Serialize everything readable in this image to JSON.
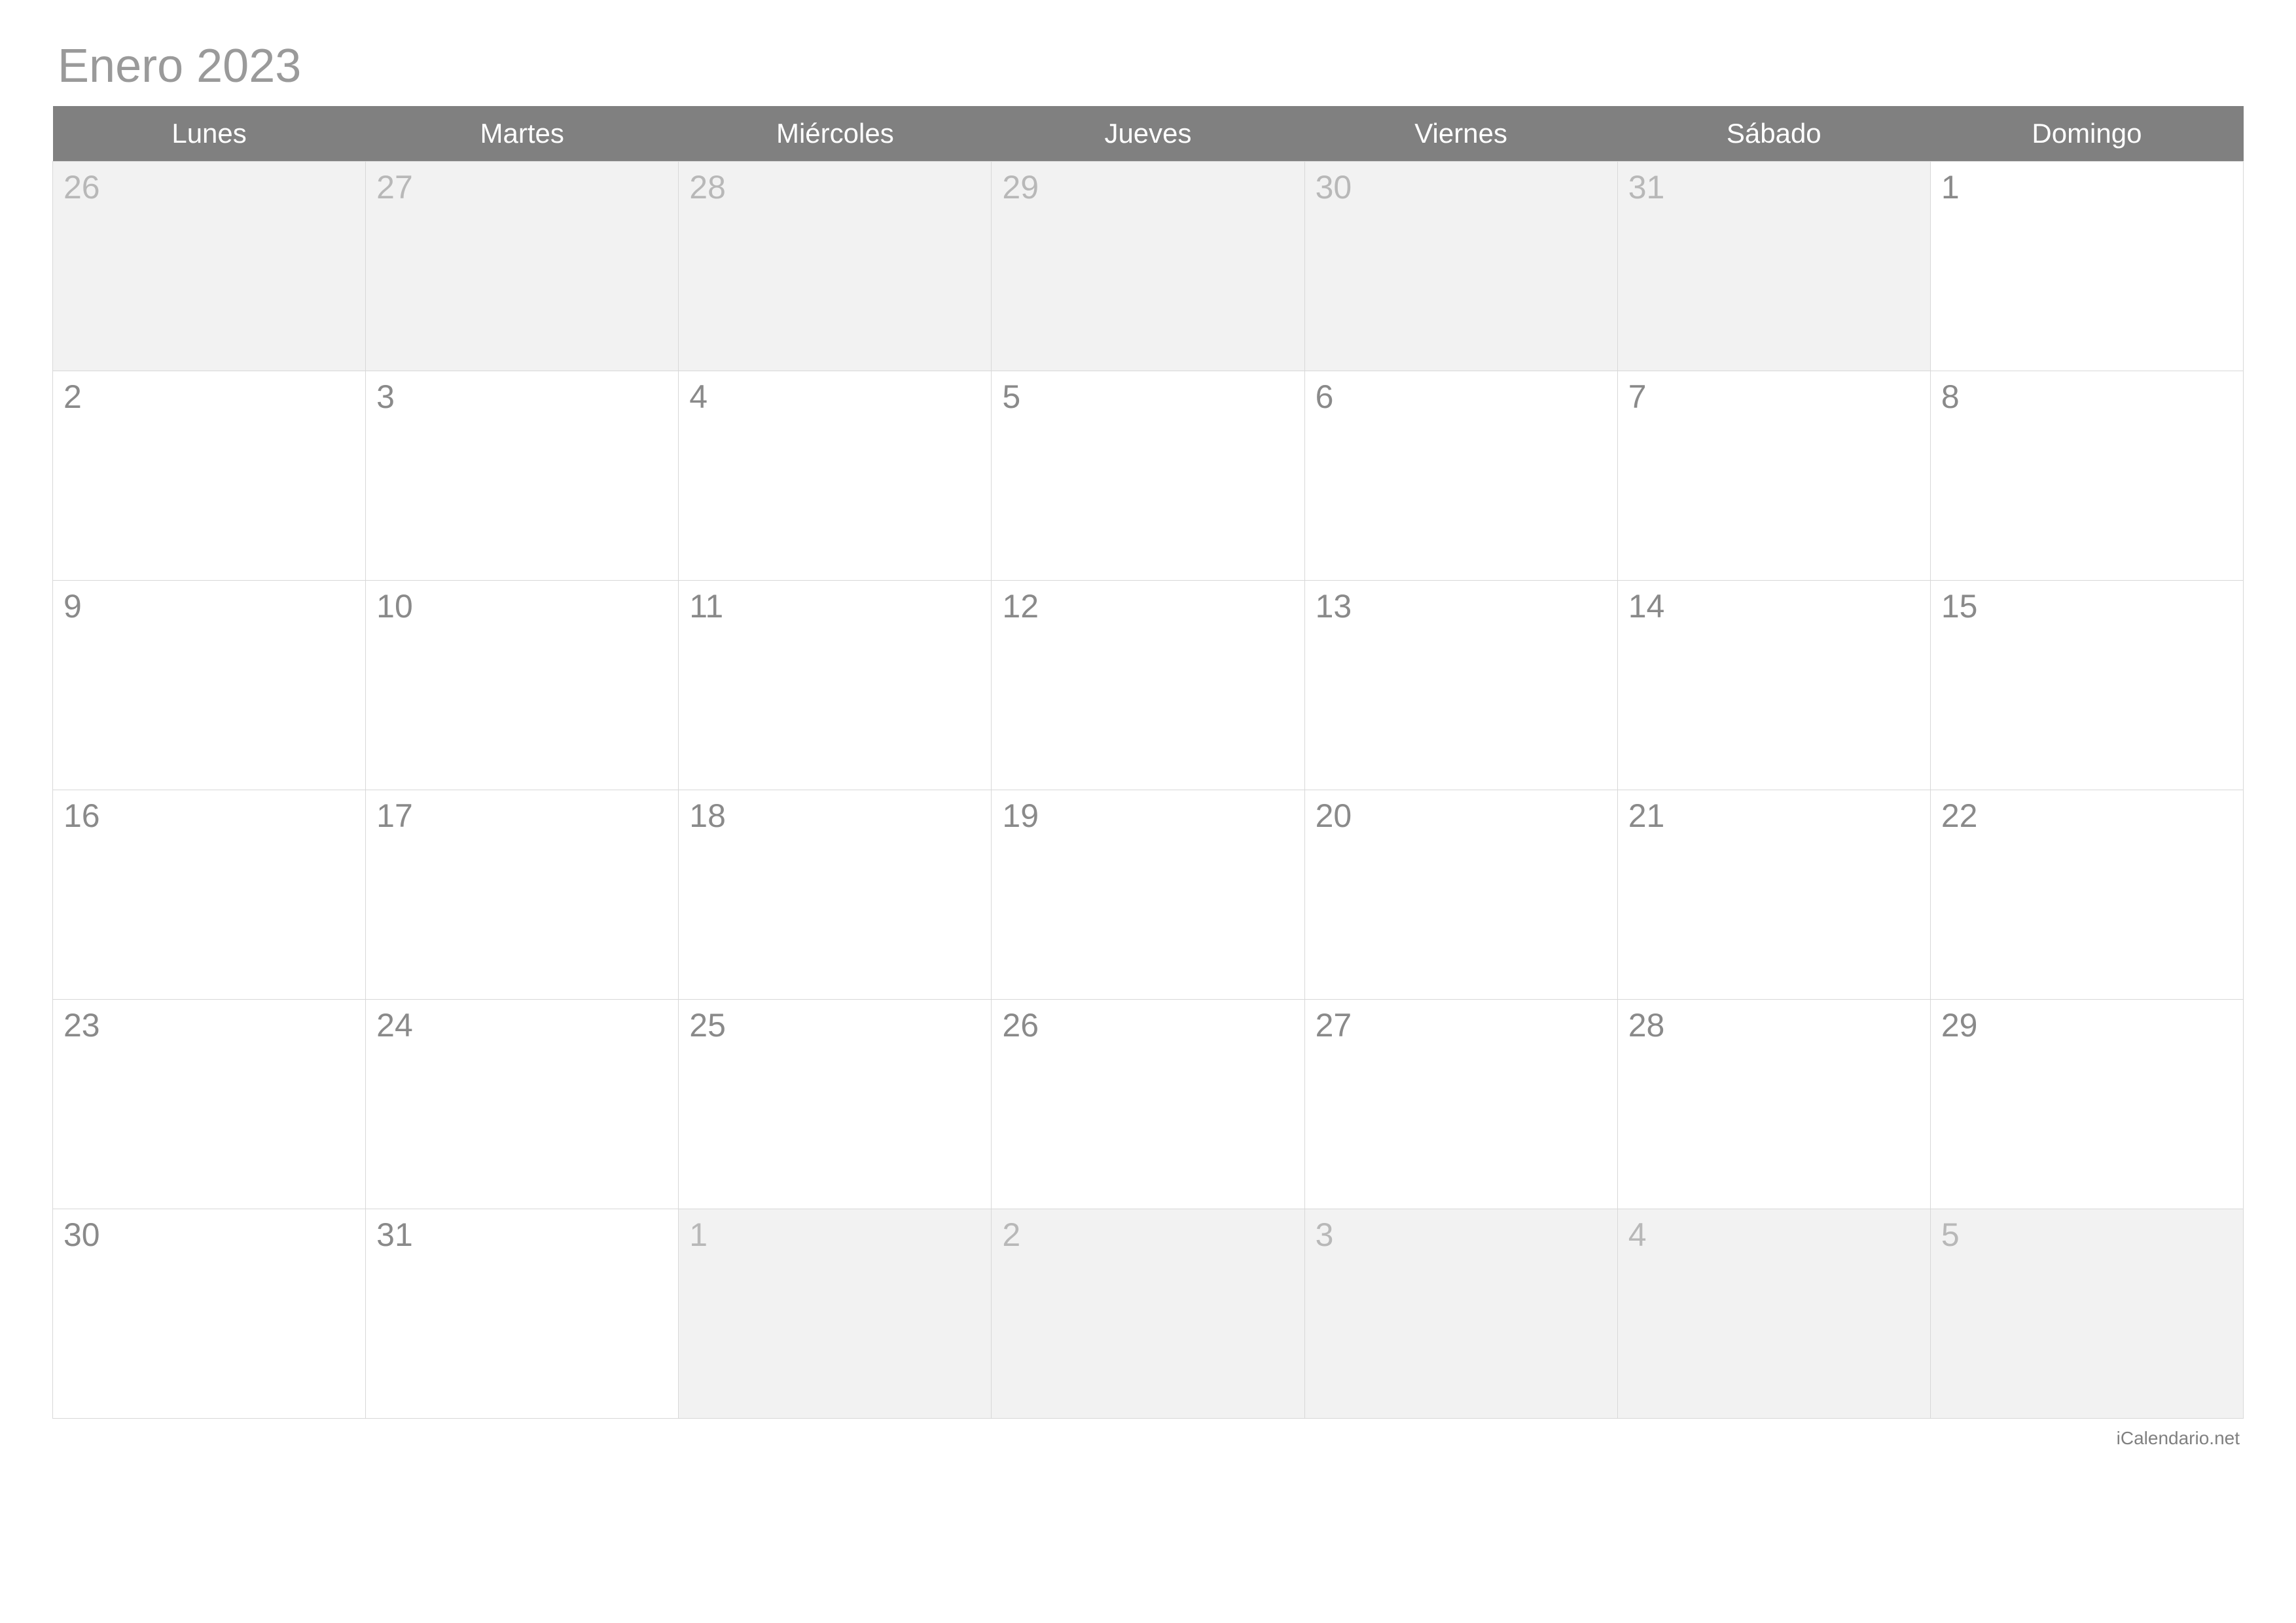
{
  "title": "Enero 2023",
  "dayHeaders": [
    "Lunes",
    "Martes",
    "Miércoles",
    "Jueves",
    "Viernes",
    "Sábado",
    "Domingo"
  ],
  "weeks": [
    [
      {
        "num": "26",
        "outside": true
      },
      {
        "num": "27",
        "outside": true
      },
      {
        "num": "28",
        "outside": true
      },
      {
        "num": "29",
        "outside": true
      },
      {
        "num": "30",
        "outside": true
      },
      {
        "num": "31",
        "outside": true
      },
      {
        "num": "1",
        "outside": false
      }
    ],
    [
      {
        "num": "2",
        "outside": false
      },
      {
        "num": "3",
        "outside": false
      },
      {
        "num": "4",
        "outside": false
      },
      {
        "num": "5",
        "outside": false
      },
      {
        "num": "6",
        "outside": false
      },
      {
        "num": "7",
        "outside": false
      },
      {
        "num": "8",
        "outside": false
      }
    ],
    [
      {
        "num": "9",
        "outside": false
      },
      {
        "num": "10",
        "outside": false
      },
      {
        "num": "11",
        "outside": false
      },
      {
        "num": "12",
        "outside": false
      },
      {
        "num": "13",
        "outside": false
      },
      {
        "num": "14",
        "outside": false
      },
      {
        "num": "15",
        "outside": false
      }
    ],
    [
      {
        "num": "16",
        "outside": false
      },
      {
        "num": "17",
        "outside": false
      },
      {
        "num": "18",
        "outside": false
      },
      {
        "num": "19",
        "outside": false
      },
      {
        "num": "20",
        "outside": false
      },
      {
        "num": "21",
        "outside": false
      },
      {
        "num": "22",
        "outside": false
      }
    ],
    [
      {
        "num": "23",
        "outside": false
      },
      {
        "num": "24",
        "outside": false
      },
      {
        "num": "25",
        "outside": false
      },
      {
        "num": "26",
        "outside": false
      },
      {
        "num": "27",
        "outside": false
      },
      {
        "num": "28",
        "outside": false
      },
      {
        "num": "29",
        "outside": false
      }
    ],
    [
      {
        "num": "30",
        "outside": false
      },
      {
        "num": "31",
        "outside": false
      },
      {
        "num": "1",
        "outside": true
      },
      {
        "num": "2",
        "outside": true
      },
      {
        "num": "3",
        "outside": true
      },
      {
        "num": "4",
        "outside": true
      },
      {
        "num": "5",
        "outside": true
      }
    ]
  ],
  "credit": "iCalendario.net"
}
